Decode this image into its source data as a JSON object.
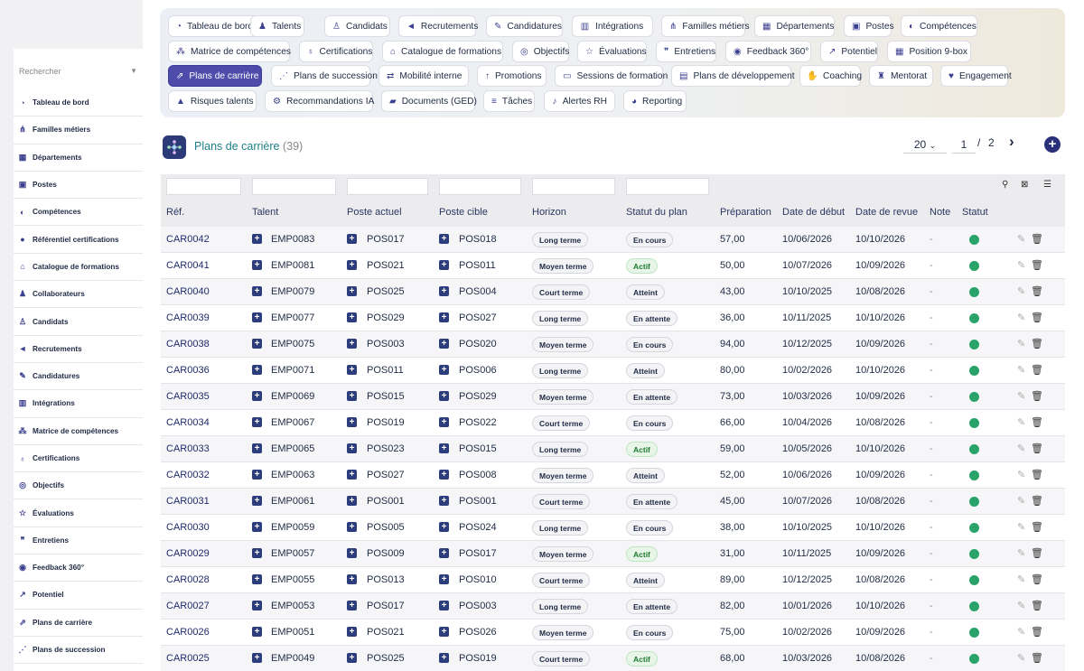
{
  "sidebar": {
    "search_placeholder": "Rechercher",
    "items": [
      {
        "label": "Tableau de bord",
        "icon": "dashboard-icon"
      },
      {
        "label": "Familles métiers",
        "icon": "sitemap-icon"
      },
      {
        "label": "Départements",
        "icon": "building-icon"
      },
      {
        "label": "Postes",
        "icon": "id-badge-icon"
      },
      {
        "label": "Compétences",
        "icon": "brain-icon"
      },
      {
        "label": "Référentiel certifications",
        "icon": "certificate-icon"
      },
      {
        "label": "Catalogue de formations",
        "icon": "graduation-cap-icon"
      },
      {
        "label": "Collaborateurs",
        "icon": "user-icon"
      },
      {
        "label": "Candidats",
        "icon": "user-plus-icon"
      },
      {
        "label": "Recrutements",
        "icon": "bullhorn-icon"
      },
      {
        "label": "Candidatures",
        "icon": "file-edit-icon"
      },
      {
        "label": "Intégrations",
        "icon": "building-door-icon"
      },
      {
        "label": "Matrice de compétences",
        "icon": "matrix-icon"
      },
      {
        "label": "Certifications",
        "icon": "award-icon"
      },
      {
        "label": "Objectifs",
        "icon": "target-icon"
      },
      {
        "label": "Évaluations",
        "icon": "star-icon"
      },
      {
        "label": "Entretiens",
        "icon": "comments-icon"
      },
      {
        "label": "Feedback 360°",
        "icon": "comment-icon"
      },
      {
        "label": "Potentiel",
        "icon": "chart-line-icon"
      },
      {
        "label": "Plans de carrière",
        "icon": "career-icon"
      },
      {
        "label": "Plans de succession",
        "icon": "hierarchy-icon"
      }
    ]
  },
  "topnav": {
    "rows": [
      [
        {
          "label": "Tableau de bord",
          "icon": "dashboard-icon"
        },
        {
          "label": "Talents",
          "icon": "user-icon"
        },
        {
          "label": "Candidats",
          "icon": "user-plus-icon"
        },
        {
          "label": "Recrutements",
          "icon": "bullhorn-icon"
        },
        {
          "label": "Candidatures",
          "icon": "file-edit-icon"
        },
        {
          "label": "Intégrations",
          "icon": "building-door-icon"
        },
        {
          "label": "Familles métiers",
          "icon": "sitemap-icon"
        },
        {
          "label": "Départements",
          "icon": "building-icon"
        },
        {
          "label": "Postes",
          "icon": "id-badge-icon"
        },
        {
          "label": "Compétences",
          "icon": "brain-icon"
        }
      ],
      [
        {
          "label": "Matrice de compétences",
          "icon": "matrix-icon"
        },
        {
          "label": "Certifications",
          "icon": "award-icon"
        },
        {
          "label": "Catalogue de formations",
          "icon": "graduation-cap-icon"
        },
        {
          "label": "Objectifs",
          "icon": "target-icon"
        },
        {
          "label": "Évaluations",
          "icon": "star-icon"
        },
        {
          "label": "Entretiens",
          "icon": "comments-icon"
        },
        {
          "label": "Feedback 360°",
          "icon": "comment-icon"
        },
        {
          "label": "Potentiel",
          "icon": "chart-line-icon"
        },
        {
          "label": "Position 9-box",
          "icon": "grid-icon"
        }
      ],
      [
        {
          "label": "Plans de carrière",
          "icon": "career-icon",
          "active": true
        },
        {
          "label": "Plans de succession",
          "icon": "hierarchy-icon"
        },
        {
          "label": "Mobilité interne",
          "icon": "exchange-icon"
        },
        {
          "label": "Promotions",
          "icon": "arrow-up-icon"
        },
        {
          "label": "Sessions de formation",
          "icon": "chalkboard-icon"
        },
        {
          "label": "Plans de développement",
          "icon": "clipboard-icon"
        },
        {
          "label": "Coaching",
          "icon": "handshake-icon"
        },
        {
          "label": "Mentorat",
          "icon": "mentor-icon"
        },
        {
          "label": "Engagement",
          "icon": "heart-icon"
        }
      ],
      [
        {
          "label": "Risques talents",
          "icon": "warning-icon"
        },
        {
          "label": "Recommandations IA",
          "icon": "robot-icon"
        },
        {
          "label": "Documents (GED)",
          "icon": "folder-icon"
        },
        {
          "label": "Tâches",
          "icon": "list-check-icon"
        },
        {
          "label": "Alertes RH",
          "icon": "bell-icon"
        },
        {
          "label": "Reporting",
          "icon": "pie-chart-icon"
        }
      ]
    ]
  },
  "page": {
    "title": "Plans de carrière",
    "count": "(39)"
  },
  "pager": {
    "page_size": "20",
    "current_page": "1",
    "separator": "/",
    "total_pages": "2"
  },
  "table": {
    "columns": [
      "Réf.",
      "Talent",
      "Poste actuel",
      "Poste cible",
      "Horizon",
      "Statut du plan",
      "Préparation",
      "Date de début",
      "Date de revue",
      "Note",
      "Statut"
    ],
    "rows": [
      {
        "ref": "CAR0042",
        "talent": "EMP0083",
        "current": "POS017",
        "target": "POS018",
        "horizon": "Long terme",
        "plan_status": "En cours",
        "prep": "57,00",
        "start": "10/06/2026",
        "review": "10/10/2026",
        "note": "-"
      },
      {
        "ref": "CAR0041",
        "talent": "EMP0081",
        "current": "POS021",
        "target": "POS011",
        "horizon": "Moyen terme",
        "plan_status": "Actif",
        "prep": "50,00",
        "start": "10/07/2026",
        "review": "10/09/2026",
        "note": "-"
      },
      {
        "ref": "CAR0040",
        "talent": "EMP0079",
        "current": "POS025",
        "target": "POS004",
        "horizon": "Court terme",
        "plan_status": "Atteint",
        "prep": "43,00",
        "start": "10/10/2025",
        "review": "10/08/2026",
        "note": "-"
      },
      {
        "ref": "CAR0039",
        "talent": "EMP0077",
        "current": "POS029",
        "target": "POS027",
        "horizon": "Long terme",
        "plan_status": "En attente",
        "prep": "36,00",
        "start": "10/11/2025",
        "review": "10/10/2026",
        "note": "-"
      },
      {
        "ref": "CAR0038",
        "talent": "EMP0075",
        "current": "POS003",
        "target": "POS020",
        "horizon": "Moyen terme",
        "plan_status": "En cours",
        "prep": "94,00",
        "start": "10/12/2025",
        "review": "10/09/2026",
        "note": "-"
      },
      {
        "ref": "CAR0036",
        "talent": "EMP0071",
        "current": "POS011",
        "target": "POS006",
        "horizon": "Long terme",
        "plan_status": "Atteint",
        "prep": "80,00",
        "start": "10/02/2026",
        "review": "10/10/2026",
        "note": "-"
      },
      {
        "ref": "CAR0035",
        "talent": "EMP0069",
        "current": "POS015",
        "target": "POS029",
        "horizon": "Moyen terme",
        "plan_status": "En attente",
        "prep": "73,00",
        "start": "10/03/2026",
        "review": "10/09/2026",
        "note": "-"
      },
      {
        "ref": "CAR0034",
        "talent": "EMP0067",
        "current": "POS019",
        "target": "POS022",
        "horizon": "Court terme",
        "plan_status": "En cours",
        "prep": "66,00",
        "start": "10/04/2026",
        "review": "10/08/2026",
        "note": "-"
      },
      {
        "ref": "CAR0033",
        "talent": "EMP0065",
        "current": "POS023",
        "target": "POS015",
        "horizon": "Long terme",
        "plan_status": "Actif",
        "prep": "59,00",
        "start": "10/05/2026",
        "review": "10/10/2026",
        "note": "-"
      },
      {
        "ref": "CAR0032",
        "talent": "EMP0063",
        "current": "POS027",
        "target": "POS008",
        "horizon": "Moyen terme",
        "plan_status": "Atteint",
        "prep": "52,00",
        "start": "10/06/2026",
        "review": "10/09/2026",
        "note": "-"
      },
      {
        "ref": "CAR0031",
        "talent": "EMP0061",
        "current": "POS001",
        "target": "POS001",
        "horizon": "Court terme",
        "plan_status": "En attente",
        "prep": "45,00",
        "start": "10/07/2026",
        "review": "10/08/2026",
        "note": "-"
      },
      {
        "ref": "CAR0030",
        "talent": "EMP0059",
        "current": "POS005",
        "target": "POS024",
        "horizon": "Long terme",
        "plan_status": "En cours",
        "prep": "38,00",
        "start": "10/10/2025",
        "review": "10/10/2026",
        "note": "-"
      },
      {
        "ref": "CAR0029",
        "talent": "EMP0057",
        "current": "POS009",
        "target": "POS017",
        "horizon": "Moyen terme",
        "plan_status": "Actif",
        "prep": "31,00",
        "start": "10/11/2025",
        "review": "10/09/2026",
        "note": "-"
      },
      {
        "ref": "CAR0028",
        "talent": "EMP0055",
        "current": "POS013",
        "target": "POS010",
        "horizon": "Court terme",
        "plan_status": "Atteint",
        "prep": "89,00",
        "start": "10/12/2025",
        "review": "10/08/2026",
        "note": "-"
      },
      {
        "ref": "CAR0027",
        "talent": "EMP0053",
        "current": "POS017",
        "target": "POS003",
        "horizon": "Long terme",
        "plan_status": "En attente",
        "prep": "82,00",
        "start": "10/01/2026",
        "review": "10/10/2026",
        "note": "-"
      },
      {
        "ref": "CAR0026",
        "talent": "EMP0051",
        "current": "POS021",
        "target": "POS026",
        "horizon": "Moyen terme",
        "plan_status": "En cours",
        "prep": "75,00",
        "start": "10/02/2026",
        "review": "10/09/2026",
        "note": "-"
      },
      {
        "ref": "CAR0025",
        "talent": "EMP0049",
        "current": "POS025",
        "target": "POS019",
        "horizon": "Court terme",
        "plan_status": "Actif",
        "prep": "68,00",
        "start": "10/03/2026",
        "review": "10/08/2026",
        "note": "-"
      }
    ]
  },
  "colors": {
    "accent": "#4d4caa",
    "title_teal": "#1e7f86",
    "status_active_green": "#2aa36a",
    "navy": "#2b3d7c"
  }
}
